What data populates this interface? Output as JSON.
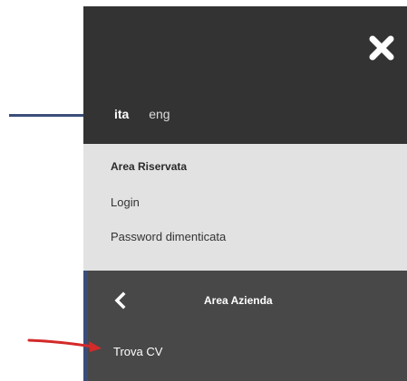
{
  "menu": {
    "close_icon": "close-icon",
    "languages": {
      "active": "ita",
      "other": "eng"
    },
    "reserved": {
      "title": "Area Riservata",
      "links": [
        "Login",
        "Password dimenticata"
      ]
    },
    "area": {
      "back_icon": "chevron-left-icon",
      "title": "Area Azienda",
      "links": [
        "Trova CV"
      ]
    }
  },
  "colors": {
    "menu_bg": "#333333",
    "reserved_bg": "#e2e2e2",
    "area_bg": "#484848",
    "accent": "#3a4d7a",
    "annotation_arrow": "#d42a2a"
  }
}
